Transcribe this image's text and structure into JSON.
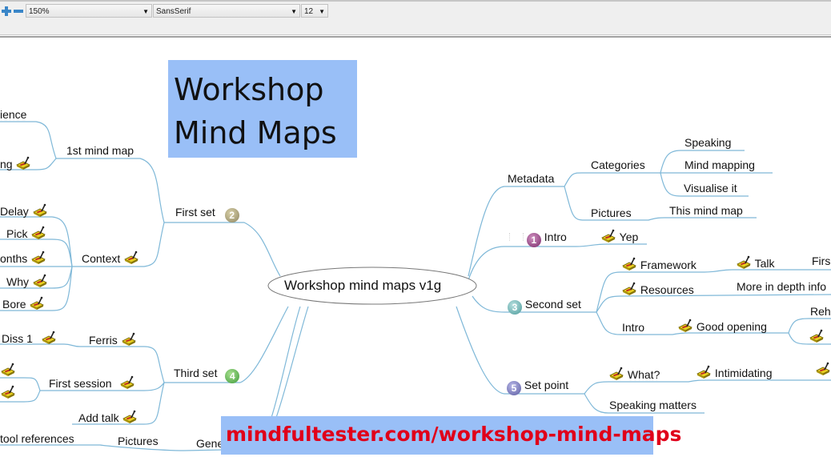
{
  "toolbar": {
    "zoom_in_icon": "plus-icon",
    "zoom_out_icon": "minus-icon",
    "zoom_value": "150%",
    "font_family": "SansSerif",
    "font_size": "12"
  },
  "overlay": {
    "title_line1": "Workshop",
    "title_line2": "Mind Maps",
    "url": "mindfultester.com/workshop-mind-maps"
  },
  "colors": {
    "link": "#7fb8d8",
    "overlay_bg": "#99bff7",
    "url_text": "#e0001a"
  },
  "mindmap": {
    "root": "Workshop mind maps v1g",
    "left": {
      "first_set": {
        "label": "First set",
        "priority": "2"
      },
      "first_mind_map": "1st mind map",
      "experience": "ience",
      "ending": "ng",
      "context": "Context",
      "delay": "Delay",
      "pick": "Pick",
      "months": "onths",
      "why": "Why",
      "bore": "Bore",
      "third_set": {
        "label": "Third set",
        "priority": "4"
      },
      "ferris": "Ferris",
      "diss1": "Diss 1",
      "first_session": "First session",
      "add_talk": "Add talk",
      "general": "Gene",
      "pictures": "Pictures",
      "tool_references": "tool references"
    },
    "right": {
      "metadata": "Metadata",
      "categories": "Categories",
      "speaking": "Speaking",
      "mind_mapping": "Mind mapping",
      "visualise_it": "Visualise it",
      "pictures": "Pictures",
      "this_mind_map": "This mind map",
      "intro": {
        "label": "Intro",
        "priority": "1"
      },
      "yep": "Yep",
      "second_set": {
        "label": "Second set",
        "priority": "3"
      },
      "framework": "Framework",
      "talk": "Talk",
      "first": "Firs",
      "resources": "Resources",
      "more_info": "More in depth info",
      "intro2": "Intro",
      "good_opening": "Good opening",
      "rehearse": "Reh",
      "set_point": {
        "label": "Set point",
        "priority": "5"
      },
      "what": "What?",
      "intimidating": "Intimidating",
      "speaking_matters": "Speaking matters"
    }
  }
}
